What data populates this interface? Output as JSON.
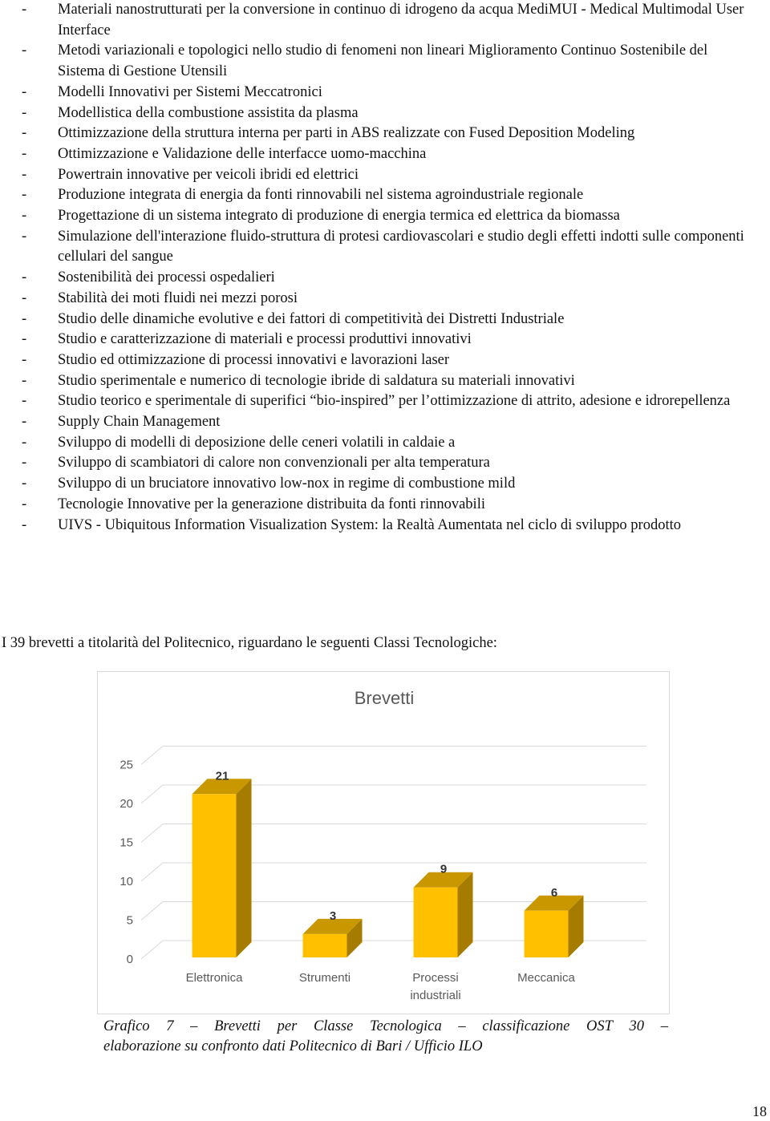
{
  "list_items": [
    {
      "bullet": "-",
      "text": "Materiali nanostrutturati per la conversione in continuo di idrogeno da acqua MediMUI - Medical Multimodal User Interface"
    },
    {
      "bullet": "-",
      "text": "Metodi variazionali e topologici nello studio di fenomeni non lineari Miglioramento Continuo Sostenibile del Sistema di Gestione Utensili"
    },
    {
      "bullet": "-",
      "text": "Modelli Innovativi per Sistemi Meccatronici"
    },
    {
      "bullet": "-",
      "text": "Modellistica della combustione assistita da plasma"
    },
    {
      "bullet": "-",
      "text": "Ottimizzazione della struttura interna per parti in ABS realizzate con Fused Deposition Modeling"
    },
    {
      "bullet": "-",
      "text": "Ottimizzazione e Validazione delle interfacce uomo-macchina"
    },
    {
      "bullet": "-",
      "text": "Powertrain innovative per veicoli ibridi ed elettrici"
    },
    {
      "bullet": "-",
      "text": "Produzione integrata di energia da fonti rinnovabili nel sistema agroindustriale regionale"
    },
    {
      "bullet": "-",
      "text": "Progettazione di un sistema integrato di produzione di energia termica ed elettrica da biomassa"
    },
    {
      "bullet": "-",
      "text": "Simulazione dell'interazione fluido-struttura di protesi cardiovascolari e studio degli effetti indotti sulle componenti cellulari del sangue"
    },
    {
      "bullet": "-",
      "text": "Sostenibilità dei processi ospedalieri"
    },
    {
      "bullet": "-",
      "text": "Stabilità dei moti fluidi nei mezzi porosi"
    },
    {
      "bullet": "-",
      "text": "Studio delle dinamiche evolutive e dei fattori di competitività dei Distretti Industriale"
    },
    {
      "bullet": "-",
      "text": "Studio e caratterizzazione di materiali e processi produttivi innovativi"
    },
    {
      "bullet": "-",
      "text": "Studio ed ottimizzazione di processi innovativi e lavorazioni laser"
    },
    {
      "bullet": "-",
      "text": "Studio sperimentale e numerico di tecnologie ibride di saldatura su materiali innovativi"
    },
    {
      "bullet": "-",
      "text": "Studio teorico e sperimentale di superifici “bio-inspired” per l’ottimizzazione di attrito, adesione e idrorepellenza"
    },
    {
      "bullet": "-",
      "text": "Supply Chain Management"
    },
    {
      "bullet": "-",
      "text": "Sviluppo di modelli di deposizione delle ceneri volatili in caldaie a"
    },
    {
      "bullet": "-",
      "text": "Sviluppo di scambiatori di calore non convenzionali per alta temperatura"
    },
    {
      "bullet": "-",
      "text": "Sviluppo di un bruciatore innovativo low-nox in regime di combustione mild"
    },
    {
      "bullet": "-",
      "text": "Tecnologie Innovative per la generazione distribuita da fonti rinnovabili"
    },
    {
      "bullet": "-",
      "text": "UIVS - Ubiquitous Information Visualization System: la Realtà Aumentata nel ciclo di sviluppo prodotto"
    }
  ],
  "intro_text": "I 39 brevetti a titolarità del Politecnico, riguardano le seguenti Classi Tecnologiche:",
  "chart_data": {
    "type": "bar",
    "style": "3d-column",
    "title": "Brevetti",
    "categories": [
      "Elettronica",
      "Strumenti",
      "Processi industriali",
      "Meccanica"
    ],
    "category_lines": [
      [
        "Elettronica"
      ],
      [
        "Strumenti"
      ],
      [
        "Processi",
        "industriali"
      ],
      [
        "Meccanica"
      ]
    ],
    "values": [
      21,
      3,
      9,
      6
    ],
    "data_labels": [
      "21",
      "3",
      "9",
      "6"
    ],
    "yticks": [
      "0",
      "5",
      "10",
      "15",
      "20",
      "25"
    ],
    "ylim": [
      0,
      25
    ],
    "xlabel": "",
    "ylabel": "",
    "grid": true,
    "legend": "none",
    "colors": {
      "front": "#ffc000",
      "top": "#c99700",
      "side": "#a67c00",
      "grid": "#d9d9d9",
      "axis_text": "#595959"
    }
  },
  "caption": {
    "line1_words": [
      "Grafico",
      "7",
      "–",
      "Brevetti",
      "per",
      "Classe",
      "Tecnologica",
      "–",
      "classificazione",
      "OST",
      "30",
      "–"
    ],
    "line2": "elaborazione su confronto dati Politecnico di Bari / Ufficio ILO"
  },
  "page_number": "18"
}
